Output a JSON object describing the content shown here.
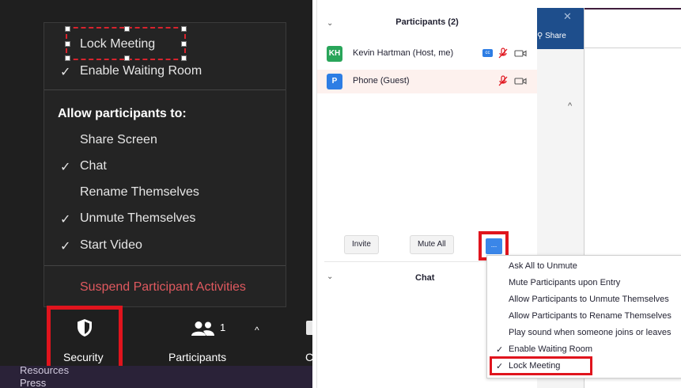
{
  "security_menu": {
    "lock_meeting": {
      "label": "Lock Meeting",
      "checked": false
    },
    "enable_waiting_room": {
      "label": "Enable Waiting Room",
      "checked": true
    },
    "section_header": "Allow participants to:",
    "options": [
      {
        "label": "Share Screen",
        "checked": false
      },
      {
        "label": "Chat",
        "checked": true
      },
      {
        "label": "Rename Themselves",
        "checked": false
      },
      {
        "label": "Unmute Themselves",
        "checked": true
      },
      {
        "label": "Start Video",
        "checked": true
      }
    ],
    "suspend_label": "Suspend Participant Activities",
    "check_glyph": "✓"
  },
  "toolbar": {
    "security_label": "Security",
    "participants_label": "Participants",
    "participants_count": "1",
    "partial_letter": "C"
  },
  "bottom_strip": {
    "partial_text": "Resources",
    "press_text": "Press"
  },
  "participants_panel": {
    "title": "Participants (2)",
    "participants": [
      {
        "initials": "KH",
        "name": "Kevin Hartman (Host, me)",
        "avatar_color": "#29a55a",
        "cc": "cc"
      },
      {
        "initials": "P",
        "name": "Phone (Guest)",
        "avatar_color": "#2d7de4"
      }
    ],
    "invite_label": "Invite",
    "mute_all_label": "Mute All",
    "more_label": "...",
    "chat_title": "Chat"
  },
  "background_window": {
    "share_label": "Share"
  },
  "more_menu": {
    "items": [
      {
        "label": "Ask All to Unmute",
        "checked": false
      },
      {
        "label": "Mute Participants upon Entry",
        "checked": false
      },
      {
        "label": "Allow Participants to Unmute Themselves",
        "checked": false
      },
      {
        "label": "Allow Participants to Rename Themselves",
        "checked": false
      },
      {
        "label": "Play sound when someone joins or leaves",
        "checked": false
      },
      {
        "label": "Enable Waiting Room",
        "checked": true
      },
      {
        "label": "Lock Meeting",
        "checked": true
      }
    ]
  },
  "colors": {
    "highlight_red": "#e0141d",
    "suspend_red": "#e0595f",
    "zoom_blue": "#2d7de4"
  }
}
